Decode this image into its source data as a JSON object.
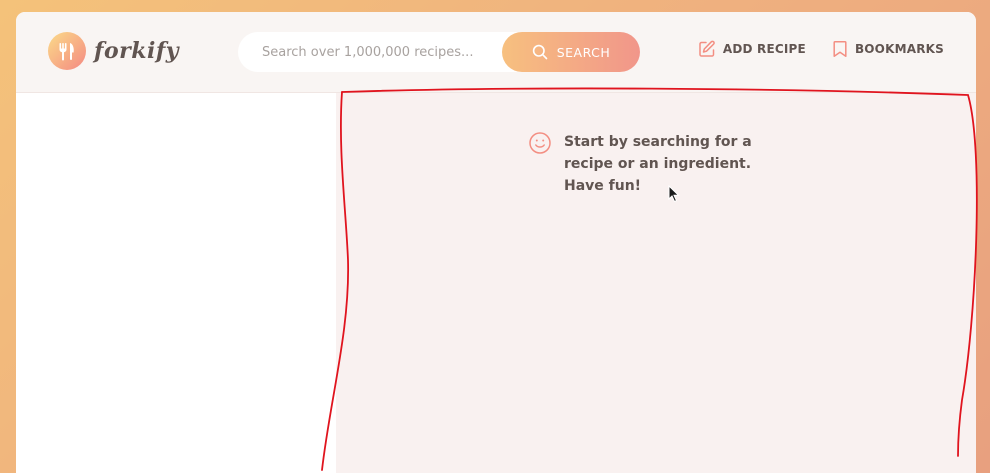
{
  "header": {
    "logo_text": "forkify",
    "search": {
      "placeholder": "Search over 1,000,000 recipes...",
      "value": "",
      "button_label": "SEARCH"
    },
    "nav": {
      "add_recipe": "ADD RECIPE",
      "bookmarks": "BOOKMARKS"
    }
  },
  "recipe": {
    "message": "Start by searching for a recipe or an ingredient. Have fun!"
  },
  "icons": {
    "logo": "fork-knife-icon",
    "search": "search-icon",
    "add_recipe": "edit-icon",
    "bookmarks": "bookmark-icon",
    "message": "smile-icon"
  },
  "colors": {
    "background_gradient_start": "#f4c27a",
    "background_gradient_end": "#e8a07f",
    "accent": "#f38e82",
    "text": "#615551",
    "annotation": "#e0141e"
  }
}
